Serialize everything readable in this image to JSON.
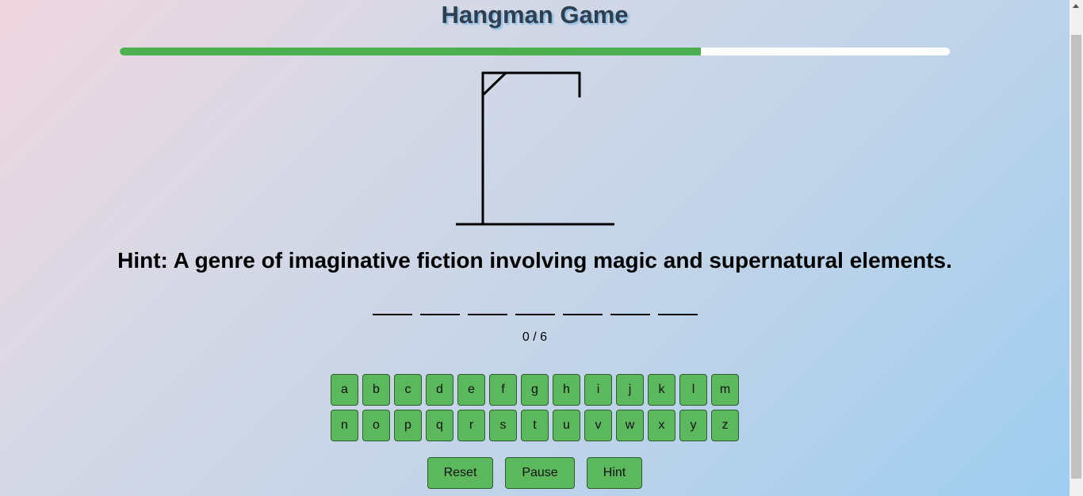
{
  "title": "Hangman Game",
  "progress": {
    "fraction": 0.7,
    "color": "#4caf50",
    "track_color": "#ffffff"
  },
  "hint": "Hint: A genre of imaginative fiction involving magic and supernatural elements.",
  "word_slot_count": 7,
  "counter": "0 / 6",
  "keyboard": {
    "row1": [
      "a",
      "b",
      "c",
      "d",
      "e",
      "f",
      "g",
      "h",
      "i",
      "j",
      "k",
      "l",
      "m"
    ],
    "row2": [
      "n",
      "o",
      "p",
      "q",
      "r",
      "s",
      "t",
      "u",
      "v",
      "w",
      "x",
      "y",
      "z"
    ]
  },
  "controls": {
    "reset_label": "Reset",
    "pause_label": "Pause",
    "hint_label": "Hint"
  },
  "colors": {
    "key_bg": "#5cb85c",
    "title_text": "#2f3f4f"
  }
}
